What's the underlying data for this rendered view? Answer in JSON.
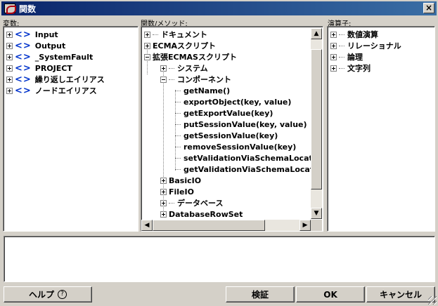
{
  "window": {
    "title": "関数",
    "close_glyph": "×"
  },
  "variables": {
    "label": "変数:",
    "items": [
      {
        "label": "Input"
      },
      {
        "label": "Output"
      },
      {
        "label": "_SystemFault"
      },
      {
        "label": "PROJECT"
      },
      {
        "label": "繰り返しエイリアス"
      },
      {
        "label": "ノードエイリアス"
      }
    ]
  },
  "functions": {
    "label": "関数/メソッド:",
    "items": [
      {
        "label": "ドキュメント"
      },
      {
        "label": "ECMAスクリプト"
      },
      {
        "label": "拡張ECMASスクリプト"
      },
      {
        "label": "システム"
      },
      {
        "label": "コンポーネント"
      },
      {
        "label": "getName()"
      },
      {
        "label": "exportObject(key, value)"
      },
      {
        "label": "getExportValue(key)"
      },
      {
        "label": "putSessionValue(key, value)"
      },
      {
        "label": "getSessionValue(key)"
      },
      {
        "label": "removeSessionValue(key)"
      },
      {
        "label": "setValidationViaSchemaLocatio"
      },
      {
        "label": "getValidationViaSchemaLocatio"
      },
      {
        "label": "BasicIO"
      },
      {
        "label": "FileIO"
      },
      {
        "label": "データベース"
      },
      {
        "label": "DatabaseRowSet"
      }
    ]
  },
  "operators": {
    "label": "演算子:",
    "items": [
      {
        "label": "数値演算"
      },
      {
        "label": "リレーショナル"
      },
      {
        "label": "論理"
      },
      {
        "label": "文字列"
      }
    ]
  },
  "icons": {
    "variable_icon": "<>",
    "up_arrow": "▲",
    "down_arrow": "▼",
    "left_arrow": "◀",
    "right_arrow": "▶"
  },
  "buttons": {
    "help": "ヘルプ",
    "help_icon": "?",
    "verify": "検証",
    "ok": "OK",
    "cancel": "キャンセル"
  },
  "expression": {
    "value": ""
  }
}
